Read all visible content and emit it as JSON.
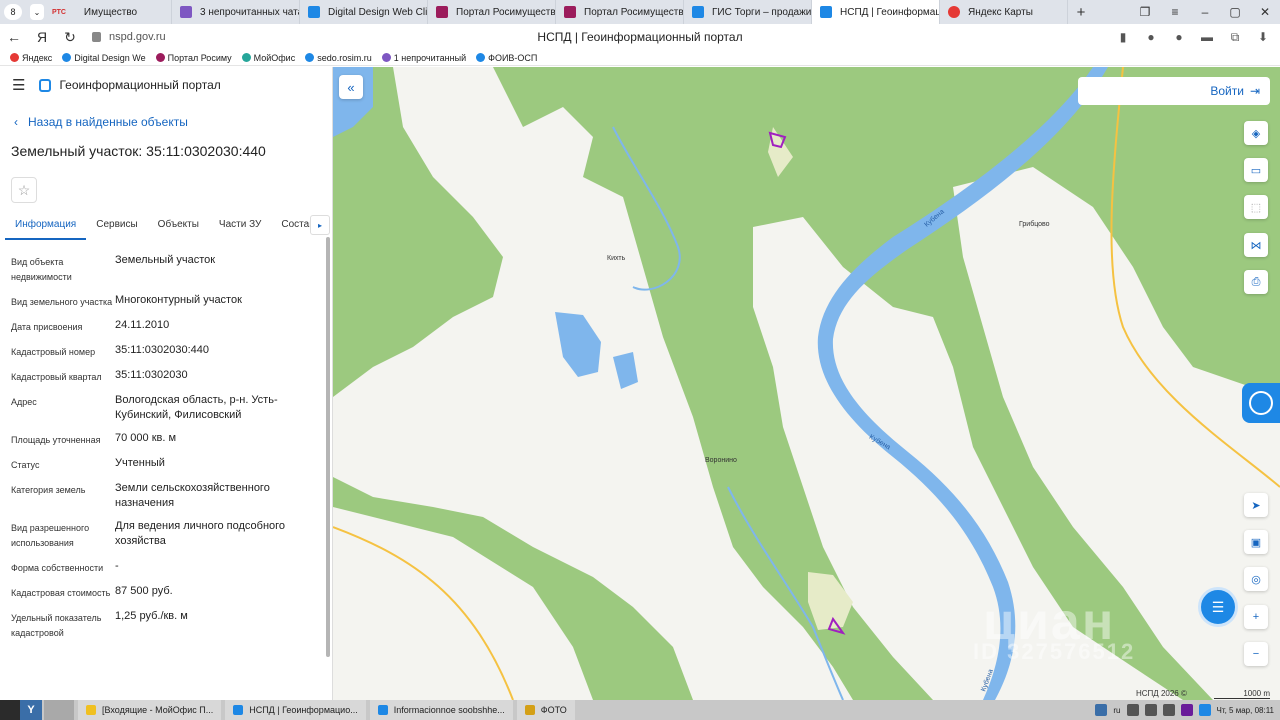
{
  "browser": {
    "tab_count": "8",
    "tabs": [
      {
        "label": "Имущество",
        "color": "#d32f2f"
      },
      {
        "label": "3 непрочитанных чата",
        "color": "#7e57c2"
      },
      {
        "label": "Digital Design Web Clien",
        "color": "#1e88e5"
      },
      {
        "label": "Портал Росимущества",
        "color": "#9c1c5c"
      },
      {
        "label": "Портал Росимущества",
        "color": "#9c1c5c"
      },
      {
        "label": "ГИС Торги – продажи г",
        "color": "#1e88e5"
      },
      {
        "label": "НСПД | Геоинформац",
        "color": "#1e88e5"
      },
      {
        "label": "Яндекс Карты",
        "color": "#e53935"
      }
    ],
    "rts_label": "РТС",
    "url": "nspd.gov.ru",
    "page_title": "НСПД | Геоинформационный портал",
    "bookmarks": [
      {
        "label": "Яндекс",
        "color": "#e53935"
      },
      {
        "label": "Digital Design We",
        "color": "#1e88e5"
      },
      {
        "label": "Портал Росиму",
        "color": "#9c1c5c"
      },
      {
        "label": "МойОфис",
        "color": "#26a69a"
      },
      {
        "label": "sedo.rosim.ru",
        "color": "#1e88e5"
      },
      {
        "label": "1 непрочитанный",
        "color": "#7e57c2"
      },
      {
        "label": "ФОИВ-ОСП",
        "color": "#1e88e5"
      }
    ]
  },
  "sidebar": {
    "app_title": "Геоинформационный портал",
    "back_label": "Назад в найденные объекты",
    "parcel_title": "Земельный участок: 35:11:0302030:440",
    "tabs": [
      "Информация",
      "Сервисы",
      "Объекты",
      "Части ЗУ",
      "Состав"
    ],
    "fields": [
      {
        "label": "Вид объекта недвижимости",
        "value": "Земельный участок"
      },
      {
        "label": "Вид земельного участка",
        "value": "Многоконтурный участок"
      },
      {
        "label": "Дата присвоения",
        "value": "24.11.2010"
      },
      {
        "label": "Кадастровый номер",
        "value": "35:11:0302030:440"
      },
      {
        "label": "Кадастровый квартал",
        "value": "35:11:0302030"
      },
      {
        "label": "Адрес",
        "value": "Вологодская область, р-н. Усть-Кубинский, Филисовский"
      },
      {
        "label": "Площадь уточненная",
        "value": "70 000 кв. м"
      },
      {
        "label": "Статус",
        "value": "Учтенный"
      },
      {
        "label": "Категория земель",
        "value": "Земли сельскохозяйственного назначения"
      },
      {
        "label": "Вид разрешенного использования",
        "value": "Для ведения личного подсобного хозяйства"
      },
      {
        "label": "Форма собственности",
        "value": "-"
      },
      {
        "label": "Кадастровая стоимость",
        "value": "87 500 руб."
      },
      {
        "label": "Удельный показатель кадастровой",
        "value": "1,25 руб./кв. м"
      }
    ]
  },
  "map": {
    "login_label": "Войти",
    "places": [
      "Кихть",
      "Воронино",
      "Грибцово",
      "Кубена",
      "Кубена",
      "Кубена"
    ],
    "watermark": "циан",
    "watermark_id": "ID 327576512",
    "copyright": "НСПД 2026 ©",
    "scale_label": "1000 m",
    "colors": {
      "forest": "#9cc97f",
      "open": "#f4f4f0",
      "river": "#7fb6ec",
      "parcel": "#a020c0"
    }
  },
  "taskbar": {
    "tasks": [
      {
        "label": "[Входящие - МойОфис П...",
        "color": "#f0c020"
      },
      {
        "label": "НСПД | Геоинформацио...",
        "color": "#1e88e5"
      },
      {
        "label": "Informacionnoe soobshhe...",
        "color": "#1e88e5"
      },
      {
        "label": "ФОТО",
        "color": "#d4a017"
      }
    ],
    "lang": "ru",
    "clock": "Чт, 5 мар, 08:11"
  }
}
